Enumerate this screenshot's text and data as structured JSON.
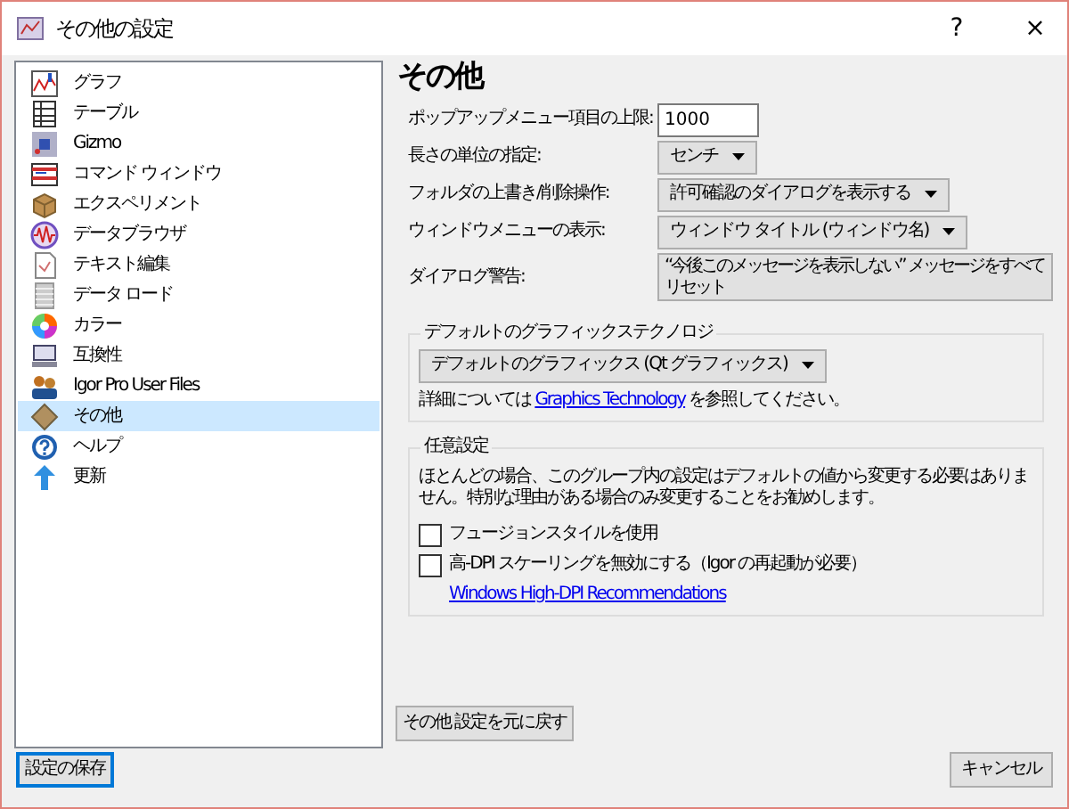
{
  "window": {
    "title": "その他の設定",
    "help_button": "?",
    "close_button": "×"
  },
  "sidebar": {
    "items": [
      {
        "label": "グラフ",
        "selected": false
      },
      {
        "label": "テーブル",
        "selected": false
      },
      {
        "label": "Gizmo",
        "selected": false
      },
      {
        "label": "コマンド ウィンドウ",
        "selected": false
      },
      {
        "label": "エクスペリメント",
        "selected": false
      },
      {
        "label": "データブラウザ",
        "selected": false
      },
      {
        "label": "テキスト編集",
        "selected": false
      },
      {
        "label": "データ ロード",
        "selected": false
      },
      {
        "label": "カラー",
        "selected": false
      },
      {
        "label": "互換性",
        "selected": false
      },
      {
        "label": "Igor Pro User Files",
        "selected": false
      },
      {
        "label": "その他",
        "selected": true
      },
      {
        "label": "ヘルプ",
        "selected": false
      },
      {
        "label": "更新",
        "selected": false
      }
    ]
  },
  "panel": {
    "title": "その他",
    "settings": [
      {
        "kind": "text",
        "label": "ポップアップメニュー項目の上限:",
        "value": "1000"
      },
      {
        "kind": "dropdown",
        "label": "長さの単位の指定:",
        "value": "センチ"
      },
      {
        "kind": "dropdown",
        "label": "フォルダの上書き/削除操作:",
        "value": "許可確認のダイアログを表示する"
      },
      {
        "kind": "dropdown",
        "label": "ウィンドウメニューの表示:",
        "value": "ウィンドウ タイトル (ウィンドウ名)"
      },
      {
        "kind": "button",
        "label": "ダイアログ警告:",
        "value": "“今後このメッセージを表示しない” メッセージをすべてリセット"
      }
    ],
    "graphics_group": {
      "title": "デフォルトのグラフィックステクノロジ",
      "dropdown": "デフォルトのグラフィックス (Qt グラフィックス)",
      "note_before": "詳細については",
      "link": "Graphics Technology",
      "note_after": "を参照してください。"
    },
    "optional_group": {
      "title": "任意設定",
      "description": "ほとんどの場合、このグループ内の設定はデフォルトの値から変更する必要はありません。特別な理由がある場合のみ変更することをお勧めします。",
      "checkboxes": [
        {
          "label": "フュージョンスタイルを使用",
          "checked": false
        },
        {
          "label": "高-DPI スケーリングを無効にする（Igor の再起動が必要）",
          "checked": false
        }
      ],
      "link": "Windows High-DPI Recommendations"
    },
    "revert_button": "その他 設定を元に戻す"
  },
  "footer": {
    "save_button": "設定の保存",
    "cancel_button": "キャンセル"
  }
}
